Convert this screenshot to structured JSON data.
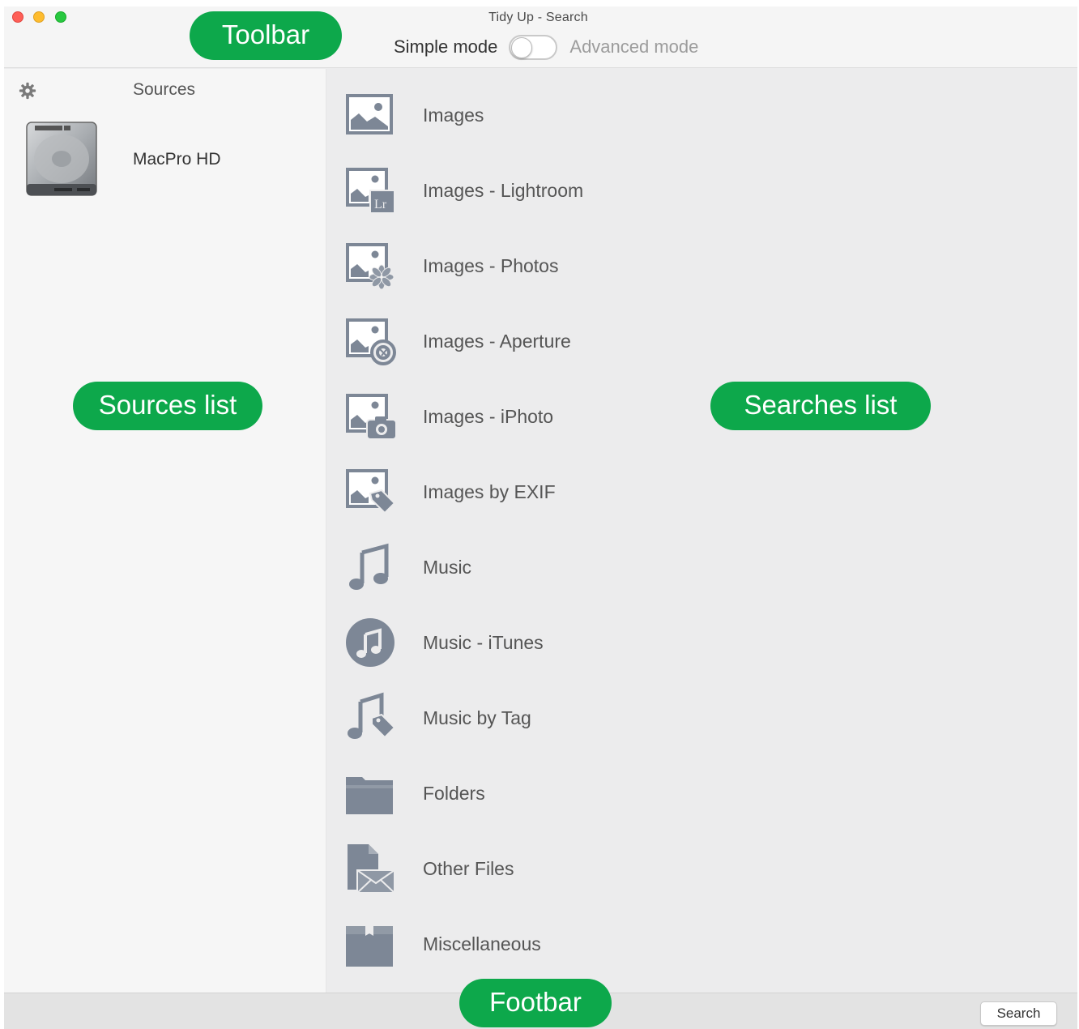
{
  "window": {
    "title": "Tidy Up - Search"
  },
  "toolbar": {
    "simple_mode_label": "Simple mode",
    "advanced_mode_label": "Advanced mode",
    "mode_toggle_state": "simple"
  },
  "sidebar": {
    "header": "Sources",
    "items": [
      {
        "label": "MacPro HD",
        "icon": "hard-drive-icon"
      }
    ]
  },
  "searches": [
    {
      "label": "Images",
      "icon": "image-icon"
    },
    {
      "label": "Images - Lightroom",
      "icon": "lightroom-image-icon"
    },
    {
      "label": "Images - Photos",
      "icon": "photos-image-icon"
    },
    {
      "label": "Images - Aperture",
      "icon": "aperture-image-icon"
    },
    {
      "label": "Images - iPhoto",
      "icon": "iphoto-image-icon"
    },
    {
      "label": "Images by EXIF",
      "icon": "exif-image-icon"
    },
    {
      "label": "Music",
      "icon": "music-note-icon"
    },
    {
      "label": "Music - iTunes",
      "icon": "itunes-icon"
    },
    {
      "label": "Music by Tag",
      "icon": "music-tag-icon"
    },
    {
      "label": "Folders",
      "icon": "folder-icon"
    },
    {
      "label": "Other Files",
      "icon": "other-files-icon"
    },
    {
      "label": "Miscellaneous",
      "icon": "box-icon"
    }
  ],
  "footbar": {
    "search_button_label": "Search"
  },
  "annotations": {
    "toolbar": "Toolbar",
    "sources_list": "Sources list",
    "searches_list": "Searches list",
    "footbar": "Footbar"
  },
  "colors": {
    "icon_gray": "#7d8796",
    "callout_green": "#0da84b"
  }
}
